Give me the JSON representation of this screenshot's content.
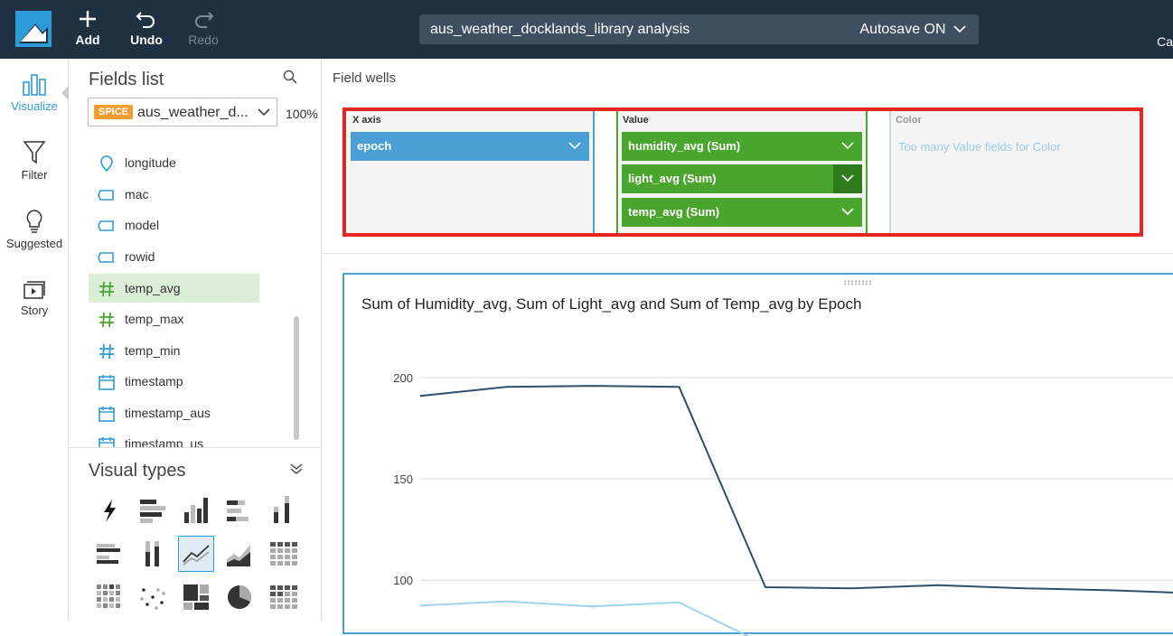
{
  "topbar": {
    "add_label": "Add",
    "undo_label": "Undo",
    "redo_label": "Redo",
    "analysis_name": "aus_weather_docklands_library analysis",
    "autosave": "Autosave ON",
    "clipped_right": "Ca"
  },
  "rail": {
    "items": [
      {
        "label": "Visualize",
        "icon": "bar-chart-icon"
      },
      {
        "label": "Filter",
        "icon": "funnel-icon"
      },
      {
        "label": "Suggested",
        "icon": "lightbulb-icon"
      },
      {
        "label": "Story",
        "icon": "play-stack-icon"
      }
    ]
  },
  "fields_panel": {
    "title": "Fields list",
    "dataset_badge": "SPICE",
    "dataset_name": "aus_weather_d...",
    "spice_usage": "100%",
    "items": [
      {
        "label": "longitude",
        "icon": "geo-pin-icon"
      },
      {
        "label": "mac",
        "icon": "string-tag-icon"
      },
      {
        "label": "model",
        "icon": "string-tag-icon"
      },
      {
        "label": "rowid",
        "icon": "string-tag-icon"
      },
      {
        "label": "temp_avg",
        "icon": "hash-icon",
        "selected": true
      },
      {
        "label": "temp_max",
        "icon": "hash-icon"
      },
      {
        "label": "temp_min",
        "icon": "hash-icon"
      },
      {
        "label": "timestamp",
        "icon": "calendar-icon"
      },
      {
        "label": "timestamp_aus",
        "icon": "calendar-icon"
      },
      {
        "label": "timestamp_us",
        "icon": "calendar-icon"
      }
    ],
    "visual_types_title": "Visual types"
  },
  "field_wells": {
    "title": "Field wells",
    "x_axis_label": "X axis",
    "x_axis_field": "epoch",
    "value_label": "Value",
    "value_fields": [
      "humidity_avg (Sum)",
      "light_avg (Sum)",
      "temp_avg (Sum)"
    ],
    "color_label": "Color",
    "color_note": "Too many Value fields for Color"
  },
  "colors": {
    "topbar_bg": "#1f3142",
    "accent_blue": "#2d9bd8",
    "chip_blue": "#4a9fd4",
    "chip_green": "#4aa52e",
    "highlight_red": "#e6261f",
    "series_dark": "#2e4f6b",
    "series_light": "#9fd3ec"
  },
  "chart_data": {
    "type": "line",
    "title": "Sum of Humidity_avg, Sum of Light_avg and Sum of Temp_avg by Epoch",
    "y_ticks": [
      100,
      150,
      200
    ],
    "ylim": [
      80,
      213
    ],
    "grid": true,
    "series": [
      {
        "name": "humidity_avg (Sum)",
        "color": "#2e4f6b",
        "values": [
          191,
          195.5,
          196,
          195.5,
          96.5,
          96,
          97.5,
          96,
          95,
          93.5
        ]
      },
      {
        "name": "light_avg (Sum)",
        "color": "#9fd3ec",
        "values": [
          87.5,
          89.5,
          87,
          89,
          68,
          null,
          null,
          null,
          null,
          null
        ]
      }
    ]
  }
}
